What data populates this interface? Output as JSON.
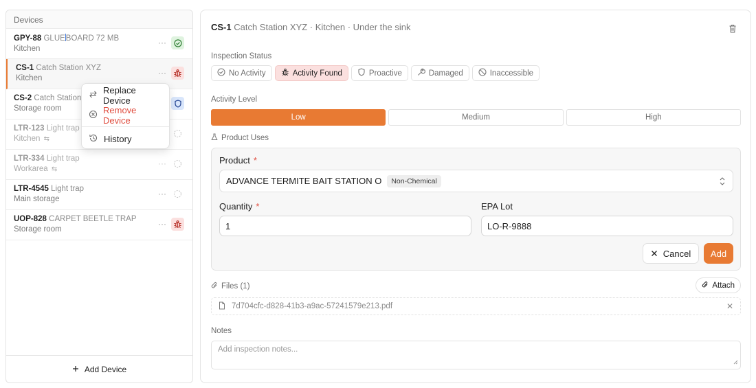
{
  "sidebar": {
    "header": "Devices",
    "devices": [
      {
        "code": "GPY-88",
        "desc_a": " GLUE",
        "desc_b": "BOARD 72 MB",
        "location": "Kitchen",
        "status": "check-circle-icon"
      },
      {
        "code": "CS-1",
        "desc": " Catch Station XYZ",
        "location": "Kitchen",
        "status": "bug-icon"
      },
      {
        "code": "CS-2",
        "desc": " Catch Station",
        "location": "Storage room",
        "status": "shield-icon"
      },
      {
        "code": "LTR-123",
        "desc": " Light trap",
        "location": "Kitchen",
        "swap": "⇆",
        "status": "dashed-circle-icon"
      },
      {
        "code": "LTR-334",
        "desc": " Light trap",
        "location": "Workarea",
        "swap": "⇆",
        "status": "dashed-circle-icon"
      },
      {
        "code": "LTR-4545",
        "desc": " Light trap",
        "location": "Main storage",
        "status": "dashed-circle-icon"
      },
      {
        "code": "UOP-828",
        "desc": " CARPET BEETLE TRAP",
        "location": "Storage room",
        "status": "bug-icon"
      }
    ],
    "dots": "···",
    "add_device_label": "Add Device"
  },
  "context_menu": {
    "replace": "Replace Device",
    "remove": "Remove Device",
    "history": "History"
  },
  "detail": {
    "code": "CS-1",
    "subtitle": " Catch Station XYZ · Kitchen · Under the sink",
    "inspection_status_label": "Inspection Status",
    "statuses": [
      {
        "label": "No Activity",
        "icon": "check-circle-icon"
      },
      {
        "label": "Activity Found",
        "icon": "bug-icon",
        "active": true
      },
      {
        "label": "Proactive",
        "icon": "shield-icon"
      },
      {
        "label": "Damaged",
        "icon": "wrench-icon"
      },
      {
        "label": "Inaccessible",
        "icon": "ban-icon"
      }
    ],
    "activity_level_label": "Activity Level",
    "levels": [
      "Low",
      "Medium",
      "High"
    ],
    "selected_level": "Low",
    "product_uses_label": "Product Uses",
    "product": {
      "product_label": "Product",
      "required_mark": "*",
      "product_value": "ADVANCE TERMITE BAIT STATION O",
      "product_tag": "Non-Chemical",
      "quantity_label": "Quantity",
      "quantity_value": "1",
      "epa_lot_label": "EPA Lot",
      "epa_lot_value": "LO-R-9888",
      "cancel_label": "Cancel",
      "add_label": "Add"
    },
    "files_label": "Files (1)",
    "attach_label": "Attach",
    "file_name": "7d704cfc-d828-41b3-a9ac-57241579e213.pdf",
    "notes_label": "Notes",
    "notes_placeholder": "Add inspection notes..."
  },
  "colors": {
    "accent": "#e87a33",
    "danger": "#e04b3d",
    "active_status_bg": "#fbe0df"
  }
}
